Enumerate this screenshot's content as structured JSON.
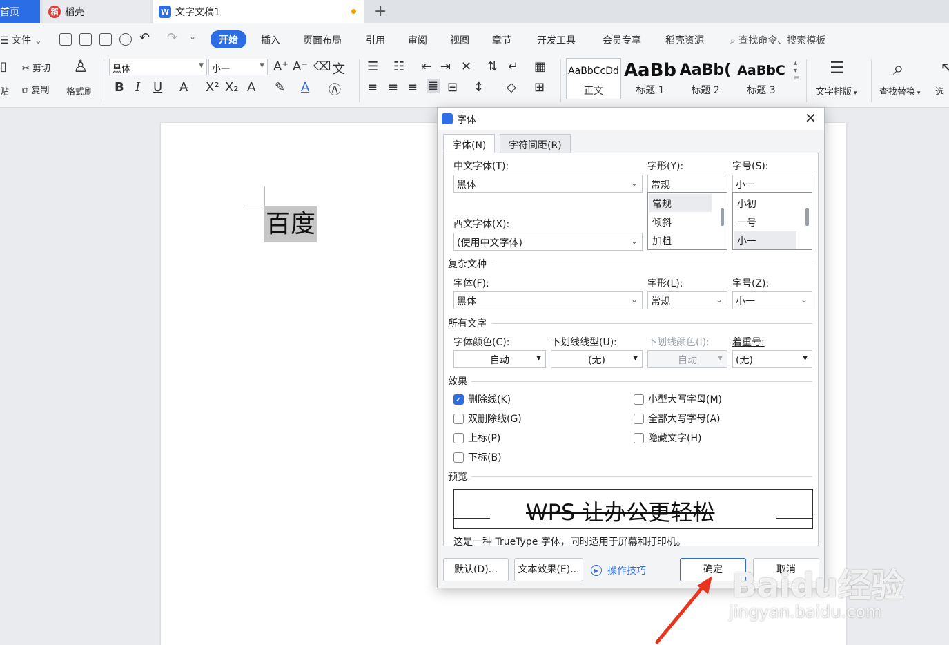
{
  "tabs": {
    "home": "首页",
    "daoke": "稻壳",
    "doc": "文字文稿1",
    "add": "+"
  },
  "menu": {
    "file": "文件",
    "items": [
      "开始",
      "插入",
      "页面布局",
      "引用",
      "审阅",
      "视图",
      "章节",
      "开发工具",
      "会员专享",
      "稻壳资源"
    ],
    "search": "查找命令、搜索模板"
  },
  "ribbon": {
    "cut": "剪切",
    "paste": "贴",
    "copy": "复制",
    "format_painter": "格式刷",
    "font_name": "黑体",
    "font_size": "小一",
    "styles": [
      {
        "sample": "AaBbCcDd",
        "name": "正文"
      },
      {
        "sample": "AaBb",
        "name": "标题 1"
      },
      {
        "sample": "AaBb(",
        "name": "标题 2"
      },
      {
        "sample": "AaBbC",
        "name": "标题 3"
      }
    ],
    "text_layout": "文字排版",
    "find_replace": "查找替换",
    "select": "选"
  },
  "document": {
    "text": "百度"
  },
  "dialog": {
    "title": "字体",
    "tabs": [
      "字体(N)",
      "字符间距(R)"
    ],
    "cn_font_label": "中文字体(T):",
    "cn_font_value": "黑体",
    "west_font_label": "西文字体(X):",
    "west_font_value": "(使用中文字体)",
    "style_label": "字形(Y):",
    "style_value": "常规",
    "style_options": [
      "常规",
      "倾斜",
      "加粗"
    ],
    "size_label": "字号(S):",
    "size_value": "小一",
    "size_options": [
      "小初",
      "一号",
      "小一"
    ],
    "complex_section": "复杂文种",
    "complex_font_label": "字体(F):",
    "complex_font_value": "黑体",
    "complex_style_label": "字形(L):",
    "complex_style_value": "常规",
    "complex_size_label": "字号(Z):",
    "complex_size_value": "小一",
    "all_text_section": "所有文字",
    "color_label": "字体颜色(C):",
    "color_value": "自动",
    "underline_label": "下划线线型(U):",
    "underline_value": "(无)",
    "underline_color_label": "下划线颜色(I):",
    "underline_color_value": "自动",
    "emphasis_label": "着重号:",
    "emphasis_value": "(无)",
    "effects_section": "效果",
    "effects": [
      {
        "label": "删除线(K)",
        "checked": true
      },
      {
        "label": "双删除线(G)",
        "checked": false
      },
      {
        "label": "上标(P)",
        "checked": false
      },
      {
        "label": "下标(B)",
        "checked": false
      },
      {
        "label": "小型大写字母(M)",
        "checked": false
      },
      {
        "label": "全部大写字母(A)",
        "checked": false
      },
      {
        "label": "隐藏文字(H)",
        "checked": false
      }
    ],
    "preview_section": "预览",
    "preview_text": "WPS 让办公更轻松",
    "preview_note": "这是一种 TrueType 字体，同时适用于屏幕和打印机。",
    "btn_default": "默认(D)...",
    "btn_text_effect": "文本效果(E)...",
    "tips": "操作技巧",
    "btn_ok": "确定",
    "btn_cancel": "取消"
  },
  "watermark": {
    "logo": "Baidu经验",
    "url": "jingyan.baidu.com"
  },
  "colors": {
    "accent": "#2b6de5",
    "arrow": "#e8341c"
  }
}
